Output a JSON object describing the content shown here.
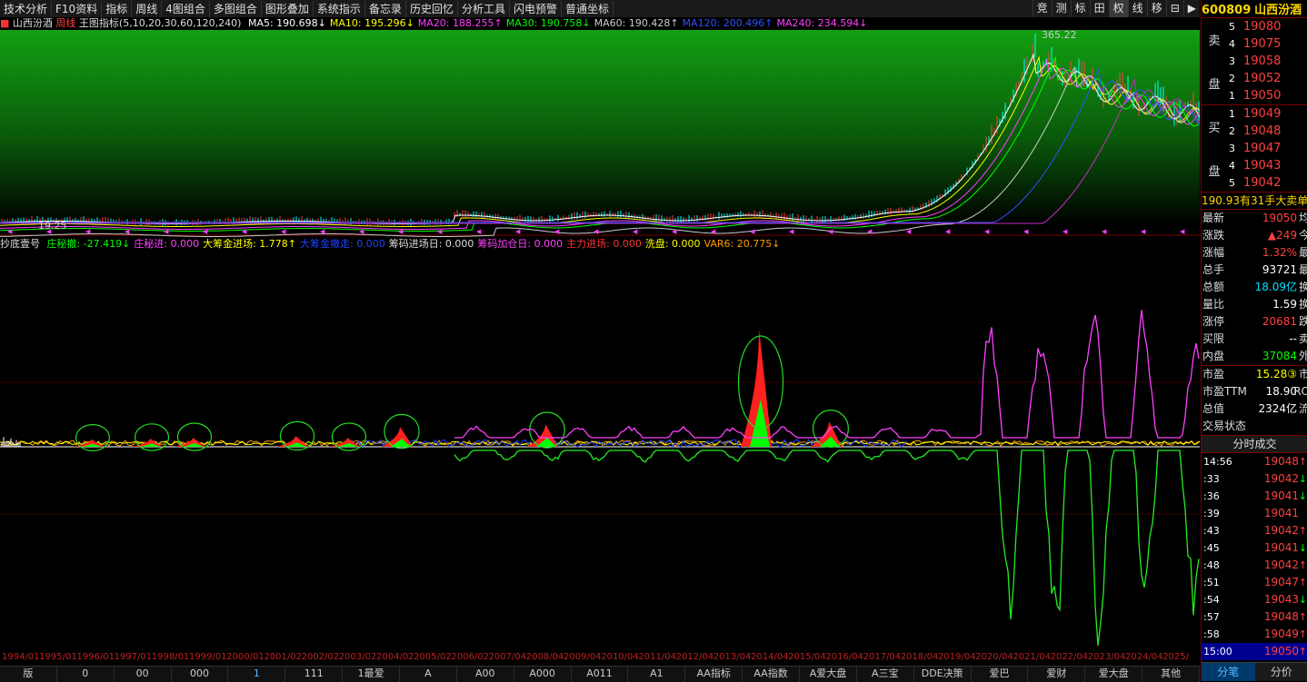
{
  "toolbar": {
    "items": [
      "技术分析",
      "F10资料",
      "指标",
      "周线",
      "4图组合",
      "多图组合",
      "图形叠加",
      "系统指示",
      "备忘录",
      "历史回忆",
      "分析工具",
      "闪电预警",
      "普通坐标"
    ],
    "right_items": [
      "竞",
      "测",
      "标",
      "田",
      "权",
      "线",
      "移",
      "⊟",
      "▶"
    ]
  },
  "main_legend": {
    "stock": "山西汾酒",
    "period": "周线",
    "indicator": "王图指标(5,10,20,30,60,120,240)",
    "items": [
      {
        "text": "MA5: 190.698↓",
        "color": "#ffffff"
      },
      {
        "text": "MA10: 195.296↓",
        "color": "#ffff00"
      },
      {
        "text": "MA20: 188.255↑",
        "color": "#ff40ff"
      },
      {
        "text": "MA30: 190.758↓",
        "color": "#00ff00"
      },
      {
        "text": "MA60: 190.428↑",
        "color": "#cccccc"
      },
      {
        "text": "MA120: 200.496↑",
        "color": "#3050ff"
      },
      {
        "text": "MA240: 234.594↓",
        "color": "#ff40ff"
      }
    ],
    "max_label": "365.22",
    "min_label": "19.25"
  },
  "indicator_legend": {
    "name": "抄底壹号",
    "items": [
      {
        "text": "庄秘撤: -27.419↓",
        "color": "#00ff00"
      },
      {
        "text": "庄秘进: 0.000",
        "color": "#ff40ff"
      },
      {
        "text": "大筹金进场: 1.778↑",
        "color": "#ffff00"
      },
      {
        "text": "大筹金撤走: 0.000",
        "color": "#2040ff"
      },
      {
        "text": "筹码进场日: 0.000",
        "color": "#dddddd"
      },
      {
        "text": "筹码加仓日: 0.000",
        "color": "#ff40ff"
      },
      {
        "text": "主力进场: 0.000",
        "color": "#ff3030"
      },
      {
        "text": "洗盘: 0.000",
        "color": "#ffff00"
      },
      {
        "text": "VAR6: 20.775↓",
        "color": "#ff9900"
      }
    ]
  },
  "time_axis": [
    "1994/01",
    "1995/01",
    "1996/01",
    "1997/01",
    "1998/01",
    "1999/01",
    "2000/01",
    "2001/02",
    "2002/02",
    "2003/02",
    "2004/02",
    "2005/02",
    "2006/02",
    "2007/04",
    "2008/04",
    "2009/04",
    "2010/04",
    "2011/04",
    "2012/04",
    "2013/04",
    "2014/04",
    "2015/04",
    "2016/04",
    "2017/04",
    "2018/04",
    "2019/04",
    "2020/04",
    "2021/04",
    "2022/04",
    "2023/04",
    "2024/04",
    "2025/"
  ],
  "bottom_tabs": [
    "版",
    "0",
    "00",
    "000",
    "1",
    "111",
    "1最爱",
    "A",
    "A00",
    "A000",
    "A011",
    "A1",
    "AA指标",
    "AA指数",
    "A爱大盘",
    "A三宝",
    "DDE决策",
    "爱巴",
    "爱财",
    "爱大盘",
    "其他"
  ],
  "bottom_tab_selected": 4,
  "quote": {
    "code": "600809",
    "name": "山西汾酒",
    "sell_label": [
      "卖",
      "盘"
    ],
    "buy_label": [
      "买",
      "盘"
    ],
    "sell": [
      {
        "level": "5",
        "price": "19080"
      },
      {
        "level": "4",
        "price": "19075"
      },
      {
        "level": "3",
        "price": "19058"
      },
      {
        "level": "2",
        "price": "19052"
      },
      {
        "level": "1",
        "price": "19050"
      }
    ],
    "buy": [
      {
        "level": "1",
        "price": "19049"
      },
      {
        "level": "2",
        "price": "19048"
      },
      {
        "level": "3",
        "price": "19047"
      },
      {
        "level": "4",
        "price": "19043"
      },
      {
        "level": "5",
        "price": "19042"
      }
    ],
    "big_order": "190.93有31手大卖单",
    "stats": [
      {
        "k": "最新",
        "v": "19050",
        "vc": "#ff4040",
        "x": "均"
      },
      {
        "k": "涨跌",
        "v": "▲249",
        "vc": "#ff4040",
        "x": "今"
      },
      {
        "k": "涨幅",
        "v": "1.32%",
        "vc": "#ff4040",
        "x": "最"
      },
      {
        "k": "总手",
        "v": "93721",
        "vc": "#ffffff",
        "x": "最"
      },
      {
        "k": "总额",
        "v": "18.09亿",
        "vc": "#00e0ff",
        "x": "换"
      },
      {
        "k": "量比",
        "v": "1.59",
        "vc": "#ffffff",
        "x": "换"
      },
      {
        "k": "涨停",
        "v": "20681",
        "vc": "#ff4040",
        "x": "跌"
      },
      {
        "k": "买限",
        "v": "--",
        "vc": "#ffffff",
        "x": "卖"
      },
      {
        "k": "内盘",
        "v": "37084",
        "vc": "#00ff00",
        "x": "外"
      }
    ],
    "stats2": [
      {
        "k": "市盈",
        "v": "15.28③",
        "vc": "#ffff00",
        "x": "市"
      },
      {
        "k": "市盈TTM",
        "v": "18.90",
        "vc": "#ffffff",
        "x": "RO"
      },
      {
        "k": "总值",
        "v": "2324亿",
        "vc": "#ffffff",
        "x": "流"
      },
      {
        "k": "交易状态",
        "v": "",
        "vc": "#ffffff",
        "x": ""
      }
    ],
    "ticks_title": "分时成交",
    "ticks": [
      {
        "t": "14:56",
        "p": "19048",
        "a": "↑",
        "ac": "#ff4040"
      },
      {
        "t": ":33",
        "p": "19042",
        "a": "↓",
        "ac": "#00ff00"
      },
      {
        "t": ":36",
        "p": "19041",
        "a": "↓",
        "ac": "#00ff00"
      },
      {
        "t": ":39",
        "p": "19041",
        "a": "",
        "ac": "#ffffff"
      },
      {
        "t": ":43",
        "p": "19042",
        "a": "↑",
        "ac": "#ff4040"
      },
      {
        "t": ":45",
        "p": "19041",
        "a": "↓",
        "ac": "#00ff00"
      },
      {
        "t": ":48",
        "p": "19042",
        "a": "↑",
        "ac": "#ff4040"
      },
      {
        "t": ":51",
        "p": "19047",
        "a": "↑",
        "ac": "#ff4040"
      },
      {
        "t": ":54",
        "p": "19043",
        "a": "↓",
        "ac": "#00ff00"
      },
      {
        "t": ":57",
        "p": "19048",
        "a": "↑",
        "ac": "#ff4040"
      },
      {
        "t": ":58",
        "p": "19049",
        "a": "↑",
        "ac": "#ff4040"
      },
      {
        "t": "15:00",
        "p": "19050",
        "a": "↑",
        "ac": "#ff4040"
      }
    ],
    "tabs": [
      "分笔",
      "分价"
    ]
  }
}
